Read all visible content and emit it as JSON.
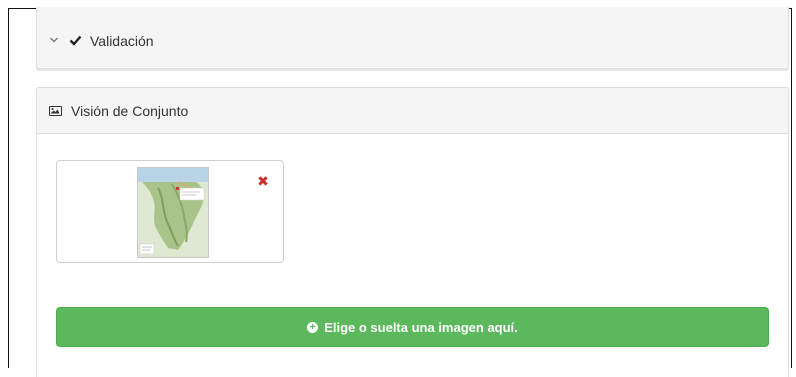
{
  "validation_panel": {
    "title": "Validación",
    "chevron_icon": "chevron-down-icon",
    "status_icon": "check-icon"
  },
  "overview_panel": {
    "title": "Visión de Conjunto",
    "icon": "picture-icon",
    "thumbnail": {
      "icon": "map-thumbnail",
      "remove_icon": "close-icon",
      "remove_symbol": "✖"
    },
    "upload_button": {
      "label": "Elige o suelta una imagen aquí.",
      "icon": "plus-circle-icon",
      "color": "#5cb85c"
    }
  }
}
